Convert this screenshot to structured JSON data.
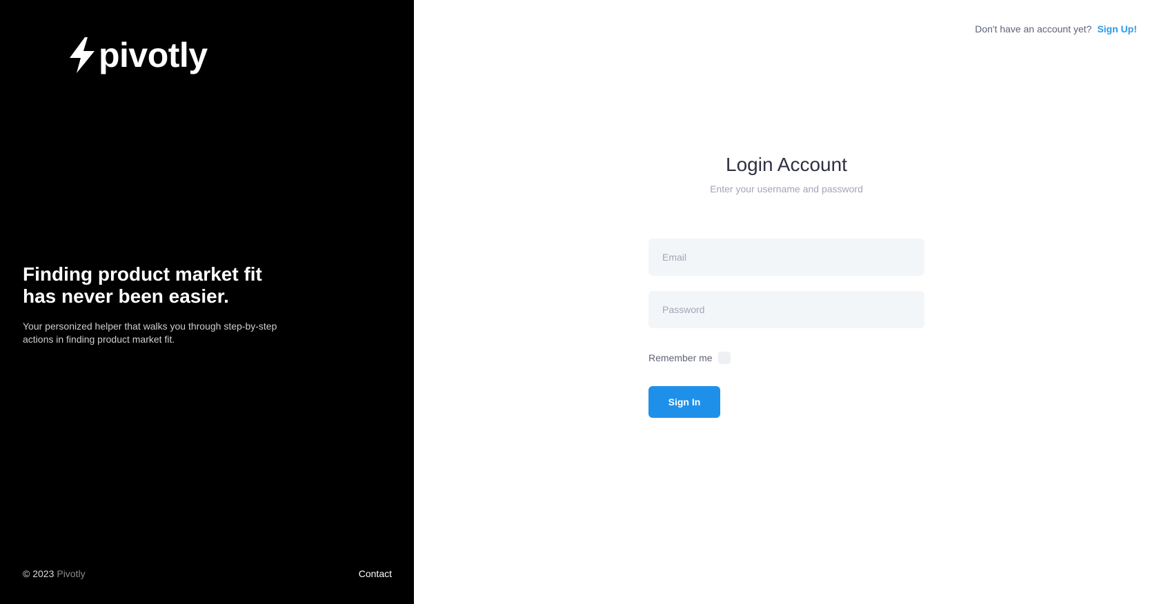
{
  "brand": {
    "logo_text": "pivotly",
    "logo_icon": "lightning-bolt-icon"
  },
  "hero": {
    "headline_line1": "Finding product market fit",
    "headline_line2": "has never been easier.",
    "subline_line1": "Your personized helper that walks you through step-by-step",
    "subline_line2": "actions in finding product market fit."
  },
  "footer": {
    "copyright": "© 2023",
    "company": "Pivotly",
    "contact_label": "Contact"
  },
  "topbar": {
    "prompt": "Don't have an account yet?",
    "signup_label": "Sign Up!"
  },
  "login": {
    "title": "Login Account",
    "subtitle": "Enter your username and password",
    "email_placeholder": "Email",
    "email_value": "",
    "password_placeholder": "Password",
    "password_value": "",
    "remember_label": "Remember me",
    "remember_checked": false,
    "submit_label": "Sign In"
  },
  "colors": {
    "accent": "#1e90ea",
    "link": "#2b9be8",
    "sidebar_bg": "#000000",
    "input_bg": "#f3f6f9"
  }
}
